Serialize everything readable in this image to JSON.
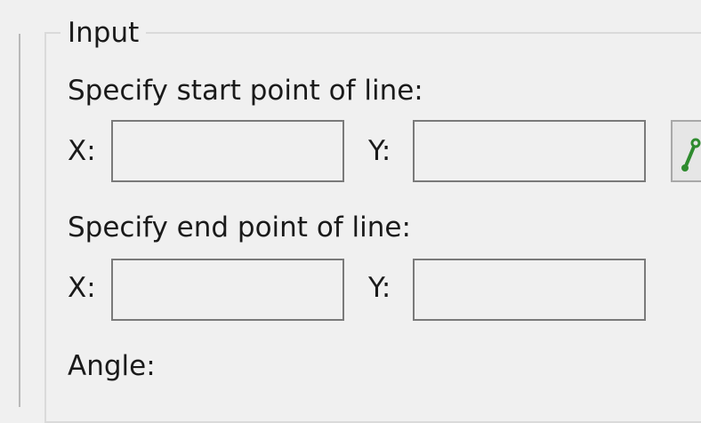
{
  "group": {
    "title": "Input"
  },
  "start_point": {
    "label": "Specify start point of line:",
    "x_label": "X:",
    "y_label": "Y:",
    "x_value": "",
    "y_value": ""
  },
  "end_point": {
    "label": "Specify end point of line:",
    "x_label": "X:",
    "y_label": "Y:",
    "x_value": "",
    "y_value": ""
  },
  "angle": {
    "label": "Angle:"
  },
  "icons": {
    "pick_points": "pick-line-points-icon"
  },
  "colors": {
    "background": "#f0f0f0",
    "textbox_border": "#7a7a7a",
    "icon_line": "#2e8b2e"
  }
}
